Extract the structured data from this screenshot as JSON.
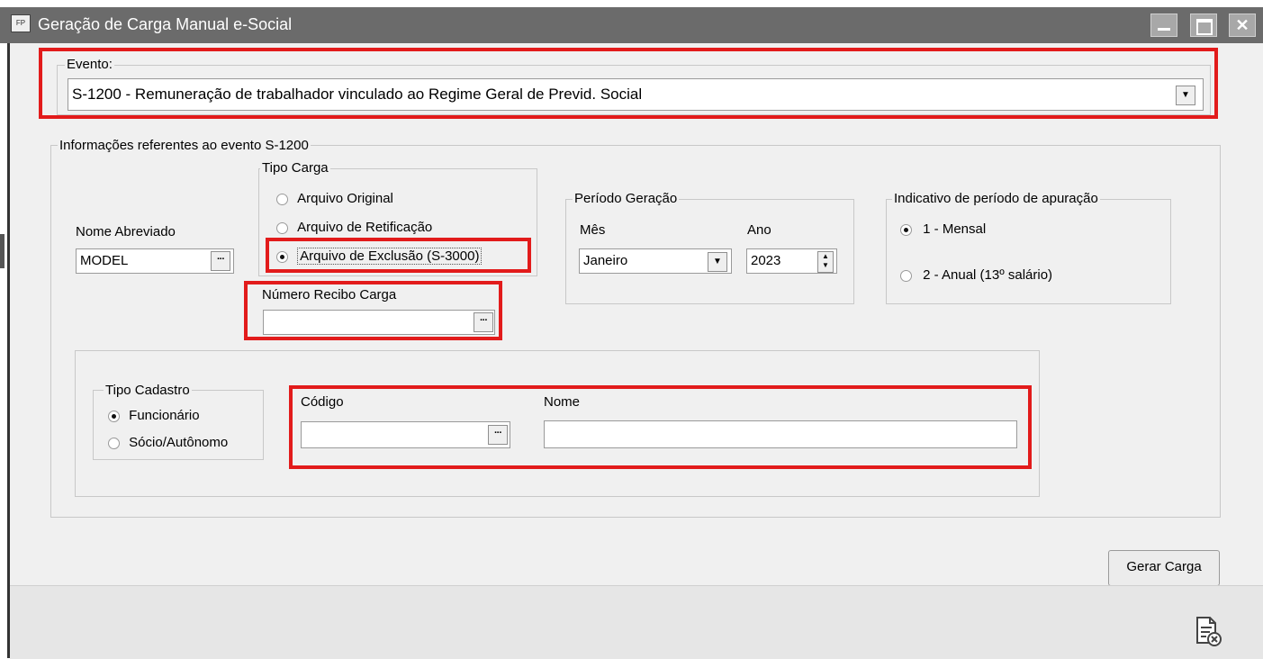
{
  "window": {
    "title": "Geração de Carga Manual e-Social",
    "icon_text": "FP",
    "buttons": [
      "minimize-icon",
      "maximize-icon",
      "close-icon"
    ]
  },
  "evento": {
    "legend": "Evento:",
    "value": "S-1200 - Remuneração de trabalhador vinculado ao Regime Geral de Previd. Social"
  },
  "info": {
    "legend": "Informações referentes ao evento S-1200",
    "nome_abreviado": {
      "label": "Nome Abreviado",
      "value": "MODEL"
    },
    "tipo_carga": {
      "legend": "Tipo Carga",
      "options": [
        "Arquivo Original",
        "Arquivo de Retificação",
        "Arquivo de Exclusão (S-3000)"
      ],
      "selected": 2
    },
    "numero_recibo": {
      "label": "Número Recibo Carga",
      "value": ""
    },
    "periodo": {
      "legend": "Período Geração",
      "mes_label": "Mês",
      "mes_value": "Janeiro",
      "ano_label": "Ano",
      "ano_value": "2023"
    },
    "indicativo": {
      "legend": "Indicativo de período de apuração",
      "options": [
        "1 - Mensal",
        "2 - Anual (13º salário)"
      ],
      "selected": 0
    },
    "tipo_cadastro": {
      "legend": "Tipo Cadastro",
      "options": [
        "Funcionário",
        "Sócio/Autônomo"
      ],
      "selected": 0
    },
    "codigo": {
      "label": "Código",
      "value": ""
    },
    "nome": {
      "label": "Nome",
      "value": ""
    }
  },
  "actions": {
    "gerar_carga": "Gerar Carga"
  },
  "footer": {
    "icon": "document-cancel-icon"
  },
  "colors": {
    "highlight": "#e21b1b",
    "titlebar": "#6b6b6b",
    "window_bg": "#f0f0f0"
  }
}
